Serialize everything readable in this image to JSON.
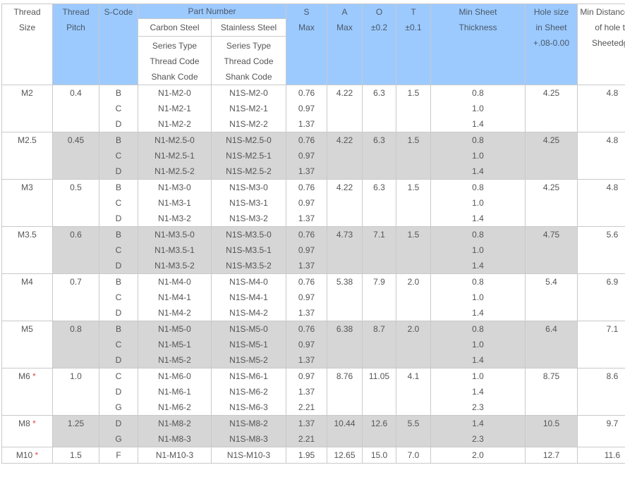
{
  "header": {
    "thread_size": [
      "Thread",
      "Size"
    ],
    "thread_pitch": [
      "Thread",
      "Pitch"
    ],
    "s_code": "S-Code",
    "part_number": "Part Number",
    "carbon_steel": "Carbon Steel",
    "stainless_steel": "Stainless Steel",
    "carbon_sub": [
      "Series Type",
      "Thread Code",
      "Shank Code"
    ],
    "stainless_sub": [
      "Series Type",
      "Thread Code",
      "Shank Code"
    ],
    "s": [
      "S",
      "Max"
    ],
    "a": [
      "A",
      "Max"
    ],
    "o": [
      "O",
      "±0.2"
    ],
    "t": [
      "T",
      "±0.1"
    ],
    "min_sheet": [
      "Min Sheet",
      "Thickness"
    ],
    "hole_size": [
      "Hole size",
      "in Sheet",
      "+.08-0.00"
    ],
    "min_distance": [
      "Min Distance C/L",
      "of hole to",
      "Sheetedge"
    ]
  },
  "rows": [
    {
      "size": "M2",
      "star": "",
      "pitch": "0.4",
      "codes": [
        "B",
        "C",
        "D"
      ],
      "carbon": [
        "N1-M2-0",
        "N1-M2-1",
        "N1-M2-2"
      ],
      "stainless": [
        "N1S-M2-0",
        "N1S-M2-1",
        "N1S-M2-2"
      ],
      "s": [
        "0.76",
        "0.97",
        "1.37"
      ],
      "a": "4.22",
      "o": "6.3",
      "t": "1.5",
      "min_sheet": [
        "0.8",
        "1.0",
        "1.4"
      ],
      "hole": "4.25",
      "dist": "4.8"
    },
    {
      "size": "M2.5",
      "star": "",
      "pitch": "0.45",
      "codes": [
        "B",
        "C",
        "D"
      ],
      "carbon": [
        "N1-M2.5-0",
        "N1-M2.5-1",
        "N1-M2.5-2"
      ],
      "stainless": [
        "N1S-M2.5-0",
        "N1S-M2.5-1",
        "N1S-M2.5-2"
      ],
      "s": [
        "0.76",
        "0.97",
        "1.37"
      ],
      "a": "4.22",
      "o": "6.3",
      "t": "1.5",
      "min_sheet": [
        "0.8",
        "1.0",
        "1.4"
      ],
      "hole": "4.25",
      "dist": "4.8"
    },
    {
      "size": "M3",
      "star": "",
      "pitch": "0.5",
      "codes": [
        "B",
        "C",
        "D"
      ],
      "carbon": [
        "N1-M3-0",
        "N1-M3-1",
        "N1-M3-2"
      ],
      "stainless": [
        "N1S-M3-0",
        "N1S-M3-1",
        "N1S-M3-2"
      ],
      "s": [
        "0.76",
        "0.97",
        "1.37"
      ],
      "a": "4.22",
      "o": "6.3",
      "t": "1.5",
      "min_sheet": [
        "0.8",
        "1.0",
        "1.4"
      ],
      "hole": "4.25",
      "dist": "4.8"
    },
    {
      "size": "M3.5",
      "star": "",
      "pitch": "0.6",
      "codes": [
        "B",
        "C",
        "D"
      ],
      "carbon": [
        "N1-M3.5-0",
        "N1-M3.5-1",
        "N1-M3.5-2"
      ],
      "stainless": [
        "N1S-M3.5-0",
        "N1S-M3.5-1",
        "N1S-M3.5-2"
      ],
      "s": [
        "0.76",
        "0.97",
        "1.37"
      ],
      "a": "4.73",
      "o": "7.1",
      "t": "1.5",
      "min_sheet": [
        "0.8",
        "1.0",
        "1.4"
      ],
      "hole": "4.75",
      "dist": "5.6"
    },
    {
      "size": "M4",
      "star": "",
      "pitch": "0.7",
      "codes": [
        "B",
        "C",
        "D"
      ],
      "carbon": [
        "N1-M4-0",
        "N1-M4-1",
        "N1-M4-2"
      ],
      "stainless": [
        "N1S-M4-0",
        "N1S-M4-1",
        "N1S-M4-2"
      ],
      "s": [
        "0.76",
        "0.97",
        "1.37"
      ],
      "a": "5.38",
      "o": "7.9",
      "t": "2.0",
      "min_sheet": [
        "0.8",
        "1.0",
        "1.4"
      ],
      "hole": "5.4",
      "dist": "6.9"
    },
    {
      "size": "M5",
      "star": "",
      "pitch": "0.8",
      "codes": [
        "B",
        "C",
        "D"
      ],
      "carbon": [
        "N1-M5-0",
        "N1-M5-1",
        "N1-M5-2"
      ],
      "stainless": [
        "N1S-M5-0",
        "N1S-M5-1",
        "N1S-M5-2"
      ],
      "s": [
        "0.76",
        "0.97",
        "1.37"
      ],
      "a": "6.38",
      "o": "8.7",
      "t": "2.0",
      "min_sheet": [
        "0.8",
        "1.0",
        "1.4"
      ],
      "hole": "6.4",
      "dist": "7.1"
    },
    {
      "size": "M6",
      "star": "*",
      "pitch": "1.0",
      "codes": [
        "C",
        "D",
        "G"
      ],
      "carbon": [
        "N1-M6-0",
        "N1-M6-1",
        "N1-M6-2"
      ],
      "stainless": [
        "N1S-M6-1",
        "N1S-M6-2",
        "N1S-M6-3"
      ],
      "s": [
        "0.97",
        "1.37",
        "2.21"
      ],
      "a": "8.76",
      "o": "11.05",
      "t": "4.1",
      "min_sheet": [
        "1.0",
        "1.4",
        "2.3"
      ],
      "hole": "8.75",
      "dist": "8.6"
    },
    {
      "size": "M8",
      "star": "*",
      "pitch": "1.25",
      "codes": [
        "D",
        "G"
      ],
      "carbon": [
        "N1-M8-2",
        "N1-M8-3"
      ],
      "stainless": [
        "N1S-M8-2",
        "N1S-M8-3"
      ],
      "s": [
        "1.37",
        "2.21"
      ],
      "a": "10.44",
      "o": "12.6",
      "t": "5.5",
      "min_sheet": [
        "1.4",
        "2.3"
      ],
      "hole": "10.5",
      "dist": "9.7"
    },
    {
      "size": "M10",
      "star": "*",
      "pitch": "1.5",
      "codes": [
        "F"
      ],
      "carbon": [
        "N1-M10-3"
      ],
      "stainless": [
        "N1S-M10-3"
      ],
      "s": [
        "1.95"
      ],
      "a": "12.65",
      "o": "15.0",
      "t": "7.0",
      "min_sheet": [
        "2.0"
      ],
      "hole": "12.7",
      "dist": "11.6"
    }
  ]
}
